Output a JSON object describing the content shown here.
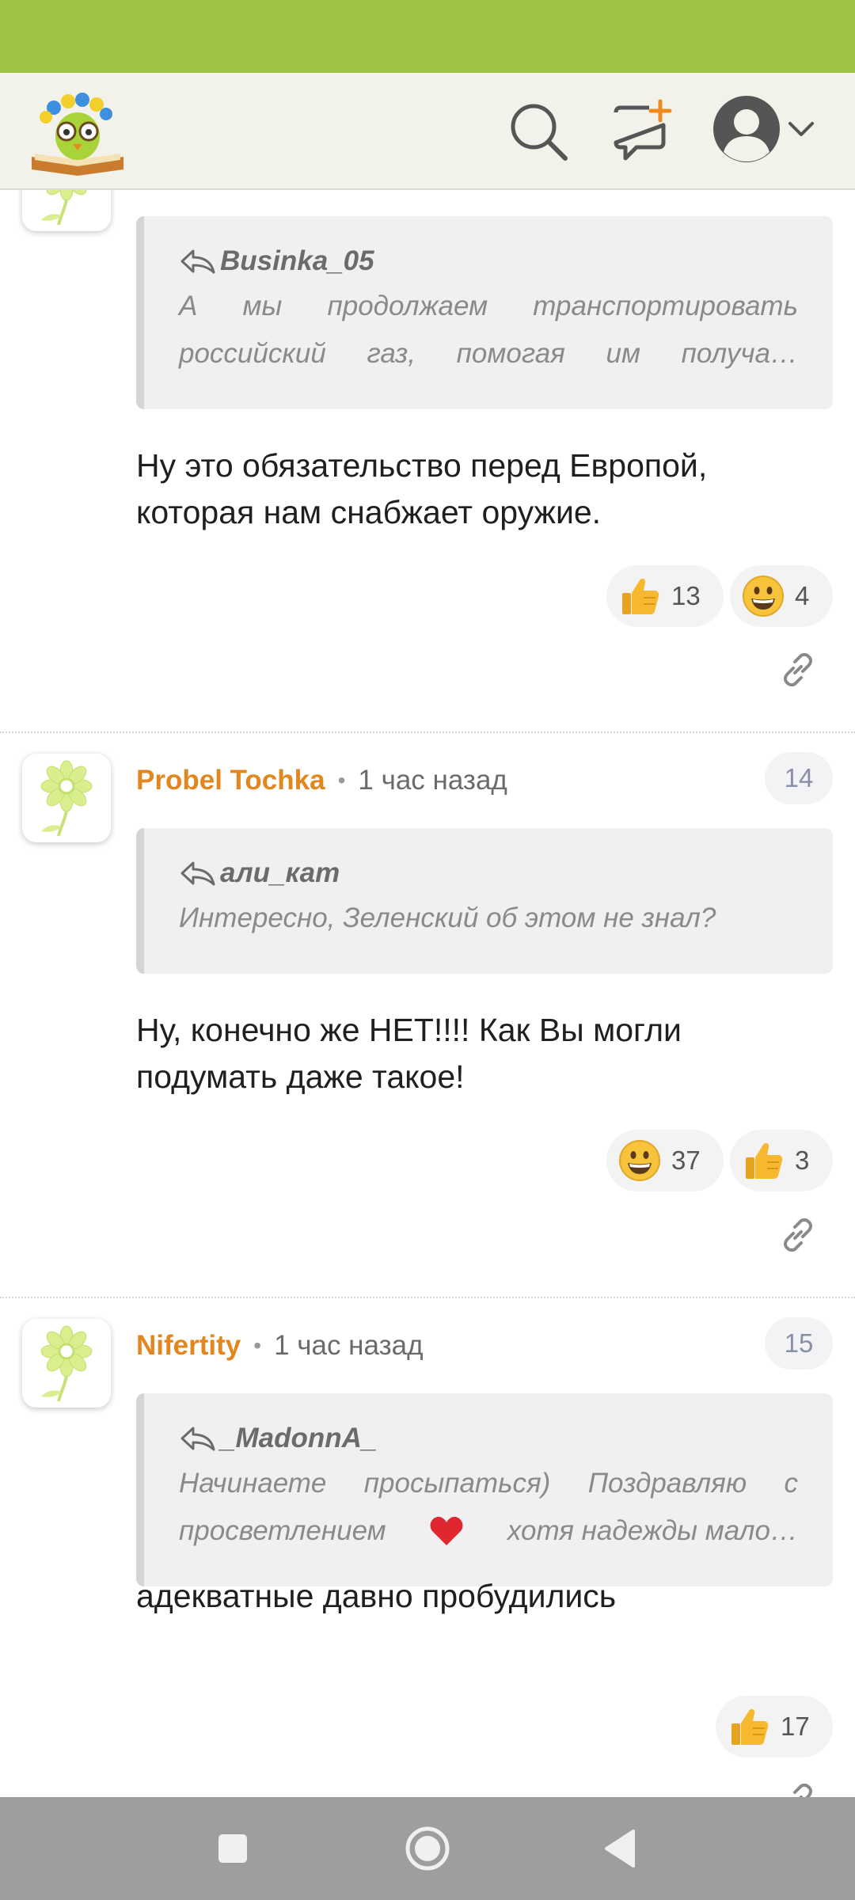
{
  "colors": {
    "status_bar": "#9dc244",
    "accent_author": "#e2861e",
    "header_bg": "#f2f2ea"
  },
  "header": {
    "logo": "owl-book-logo",
    "icons": [
      "search-icon",
      "new-message-icon",
      "profile-icon",
      "chevron-down-icon"
    ]
  },
  "comments": [
    {
      "quote": {
        "author": "Businka_05",
        "line1": "А мы продолжаем транспортировать",
        "line2": "российский газ, помогая им получа…"
      },
      "body_line1": "Ну это обязательство перед Европой,",
      "body_line2": "которая нам снабжает оружие.",
      "reactions": [
        {
          "emoji": "thumbs-up",
          "count": "13"
        },
        {
          "emoji": "grinning-face",
          "count": "4"
        }
      ]
    },
    {
      "author": "Probel Tochka",
      "separator": "•",
      "time": "1 час назад",
      "number": "14",
      "quote": {
        "author": "али_кат",
        "line1": "Интересно, Зеленский об этом не знал?"
      },
      "body_line1": "Ну, конечно же НЕТ!!!! Как Вы могли",
      "body_line2": "подумать даже такое!",
      "reactions": [
        {
          "emoji": "grinning-face",
          "count": "37"
        },
        {
          "emoji": "thumbs-up",
          "count": "3"
        }
      ]
    },
    {
      "author": "Nifertity",
      "separator": "•",
      "time": "1 час назад",
      "number": "15",
      "quote": {
        "author": "_MadonnA_",
        "line1": "Начинаете просыпаться) Поздравляю с",
        "line2a": "просветлением",
        "line2b": "хотя надежды мало…"
      },
      "body_line1": "адекватные давно пробудились",
      "reactions": [
        {
          "emoji": "thumbs-up",
          "count": "17"
        }
      ]
    }
  ],
  "navbar": {
    "buttons": [
      "recent-apps-icon",
      "home-icon",
      "back-icon"
    ]
  }
}
